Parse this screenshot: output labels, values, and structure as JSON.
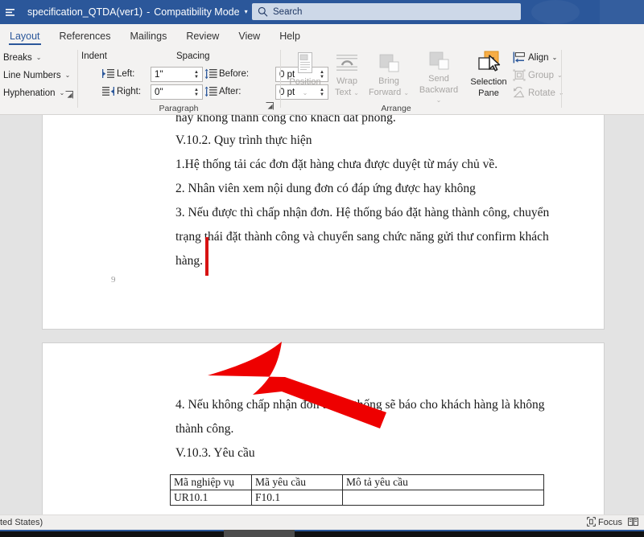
{
  "titlebar": {
    "left_icon": "autosave-icon",
    "document_title": "specification_QTDA(ver1)",
    "separator": "-",
    "compat_mode": "Compatibility Mode",
    "caret": "▾",
    "search_placeholder": "Search",
    "search_icon": "search-icon"
  },
  "tabs": [
    {
      "label": "Layout",
      "active": true
    },
    {
      "label": "References",
      "active": false
    },
    {
      "label": "Mailings",
      "active": false
    },
    {
      "label": "Review",
      "active": false
    },
    {
      "label": "View",
      "active": false
    },
    {
      "label": "Help",
      "active": false
    }
  ],
  "ribbon": {
    "page_setup": {
      "buttons": [
        {
          "label": "Breaks",
          "caret": "⌄"
        },
        {
          "label": "Line Numbers",
          "caret": "⌄"
        },
        {
          "label": "Hyphenation",
          "caret": "⌄"
        }
      ],
      "dialog_launcher": "⬌"
    },
    "paragraph": {
      "group_label": "Paragraph",
      "indent_header": "Indent",
      "spacing_header": "Spacing",
      "indent_left_label": "Left:",
      "indent_left_value": "1\"",
      "indent_right_label": "Right:",
      "indent_right_value": "0\"",
      "spacing_before_label": "Before:",
      "spacing_before_value": "0 pt",
      "spacing_after_label": "After:",
      "spacing_after_value": "0 pt",
      "dialog_launcher": "⬌"
    },
    "arrange": {
      "group_label": "Arrange",
      "buttons": [
        {
          "label_top": "Position",
          "label_bottom": "",
          "caret": "⌄",
          "enabled": false
        },
        {
          "label_top": "Wrap",
          "label_bottom": "Text",
          "caret": "⌄",
          "enabled": false
        },
        {
          "label_top": "Bring",
          "label_bottom": "Forward",
          "caret": "⌄",
          "enabled": false
        },
        {
          "label_top": "Send",
          "label_bottom": "Backward",
          "caret": "⌄",
          "enabled": false
        },
        {
          "label_top": "Selection",
          "label_bottom": "Pane",
          "caret": "",
          "enabled": true
        }
      ],
      "small_buttons": [
        {
          "label": "Align",
          "caret": "⌄",
          "enabled": true
        },
        {
          "label": "Group",
          "caret": "⌄",
          "enabled": false
        },
        {
          "label": "Rotate",
          "caret": "⌄",
          "enabled": false
        }
      ]
    }
  },
  "document": {
    "page1_lines": [
      "hay khong thanh cong cho khach dat phong.",
      "V.10.2. Quy trình thực hiện",
      "1.Hệ thống tải các đơn đặt hàng chưa được duyệt từ máy chủ về.",
      "2. Nhân viên xem nội dung đơn có đáp ứng được hay không",
      "3. Nếu được thì chấp nhận đơn. Hệ thống báo đặt hàng thành công, chuyển",
      "trạng thái đặt thành công và chuyển sang chức năng gửi thư confirm khách",
      "hàng."
    ],
    "page1_number": "9",
    "page2_lines": [
      "4. Nếu không chấp nhận đơn thì hệ thống sẽ báo cho khách hàng là không",
      "thành công.",
      "V.10.3. Yêu cầu"
    ],
    "table": {
      "headers": [
        "Mã nghiệp vụ",
        "Mã yêu cầu",
        "Mô tả yêu cầu"
      ],
      "rows": [
        [
          "UR10.1",
          "F10.1",
          ""
        ]
      ]
    },
    "annotation": {
      "name": "red-arrow-pointer",
      "color": "#ee0000",
      "marker_color": "#d71212"
    }
  },
  "statusbar": {
    "language": "ted States)",
    "focus_label": "Focus",
    "focus_icon": "focus-icon",
    "read_mode_icon": "read-mode-icon"
  },
  "colors": {
    "title_blue": "#2b579a",
    "ribbon_bg": "#f3f2f1",
    "canvas_bg": "#e3e3e3",
    "accent": "#2b579a"
  }
}
